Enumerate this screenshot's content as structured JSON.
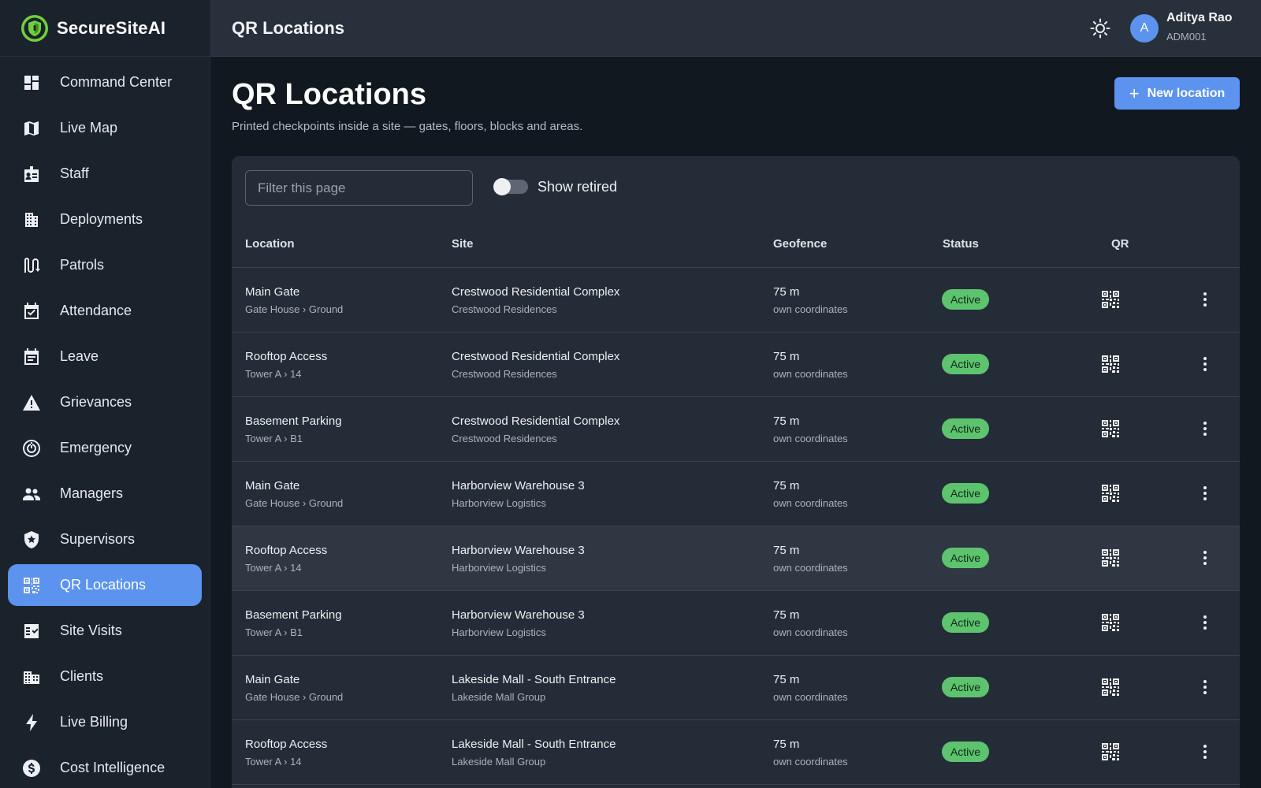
{
  "brand": {
    "name": "SecureSiteAI",
    "accent": "#6fd13b"
  },
  "sidebar": {
    "items": [
      {
        "label": "Command Center",
        "icon": "dashboard-icon"
      },
      {
        "label": "Live Map",
        "icon": "map-icon"
      },
      {
        "label": "Staff",
        "icon": "id-badge-icon"
      },
      {
        "label": "Deployments",
        "icon": "building-icon"
      },
      {
        "label": "Patrols",
        "icon": "route-icon"
      },
      {
        "label": "Attendance",
        "icon": "calendar-check-icon"
      },
      {
        "label": "Leave",
        "icon": "calendar-icon"
      },
      {
        "label": "Grievances",
        "icon": "warning-icon"
      },
      {
        "label": "Emergency",
        "icon": "emergency-icon"
      },
      {
        "label": "Managers",
        "icon": "people-icon"
      },
      {
        "label": "Supervisors",
        "icon": "shield-star-icon"
      },
      {
        "label": "QR Locations",
        "icon": "qr-code-icon",
        "active": true
      },
      {
        "label": "Site Visits",
        "icon": "checklist-icon"
      },
      {
        "label": "Clients",
        "icon": "city-icon"
      },
      {
        "label": "Live Billing",
        "icon": "bolt-icon"
      },
      {
        "label": "Cost Intelligence",
        "icon": "dollar-icon"
      }
    ]
  },
  "topbar": {
    "title": "QR Locations",
    "theme_icon": "sun-icon"
  },
  "user": {
    "initial": "A",
    "name": "Aditya Rao",
    "id": "ADM001"
  },
  "page": {
    "title": "QR Locations",
    "subtitle": "Printed checkpoints inside a site — gates, floors, blocks and areas.",
    "new_button": "New location"
  },
  "filters": {
    "placeholder": "Filter this page",
    "show_retired_label": "Show retired",
    "show_retired": false
  },
  "table": {
    "headers": {
      "location": "Location",
      "site": "Site",
      "geofence": "Geofence",
      "status": "Status",
      "qr": "QR"
    },
    "rows": [
      {
        "location": "Main Gate",
        "path": "Gate House › Ground",
        "site": "Crestwood Residential Complex",
        "client": "Crestwood Residences",
        "geofence": "75 m",
        "geo_sub": "own coordinates",
        "status": "Active"
      },
      {
        "location": "Rooftop Access",
        "path": "Tower A › 14",
        "site": "Crestwood Residential Complex",
        "client": "Crestwood Residences",
        "geofence": "75 m",
        "geo_sub": "own coordinates",
        "status": "Active"
      },
      {
        "location": "Basement Parking",
        "path": "Tower A › B1",
        "site": "Crestwood Residential Complex",
        "client": "Crestwood Residences",
        "geofence": "75 m",
        "geo_sub": "own coordinates",
        "status": "Active"
      },
      {
        "location": "Main Gate",
        "path": "Gate House › Ground",
        "site": "Harborview Warehouse 3",
        "client": "Harborview Logistics",
        "geofence": "75 m",
        "geo_sub": "own coordinates",
        "status": "Active"
      },
      {
        "location": "Rooftop Access",
        "path": "Tower A › 14",
        "site": "Harborview Warehouse 3",
        "client": "Harborview Logistics",
        "geofence": "75 m",
        "geo_sub": "own coordinates",
        "status": "Active",
        "hovered": true
      },
      {
        "location": "Basement Parking",
        "path": "Tower A › B1",
        "site": "Harborview Warehouse 3",
        "client": "Harborview Logistics",
        "geofence": "75 m",
        "geo_sub": "own coordinates",
        "status": "Active"
      },
      {
        "location": "Main Gate",
        "path": "Gate House › Ground",
        "site": "Lakeside Mall - South Entrance",
        "client": "Lakeside Mall Group",
        "geofence": "75 m",
        "geo_sub": "own coordinates",
        "status": "Active"
      },
      {
        "location": "Rooftop Access",
        "path": "Tower A › 14",
        "site": "Lakeside Mall - South Entrance",
        "client": "Lakeside Mall Group",
        "geofence": "75 m",
        "geo_sub": "own coordinates",
        "status": "Active"
      }
    ]
  },
  "colors": {
    "accent": "#5b93ee",
    "status_active": "#5dc36f",
    "sidebar_bg": "#1a222c",
    "page_bg": "#111820"
  }
}
